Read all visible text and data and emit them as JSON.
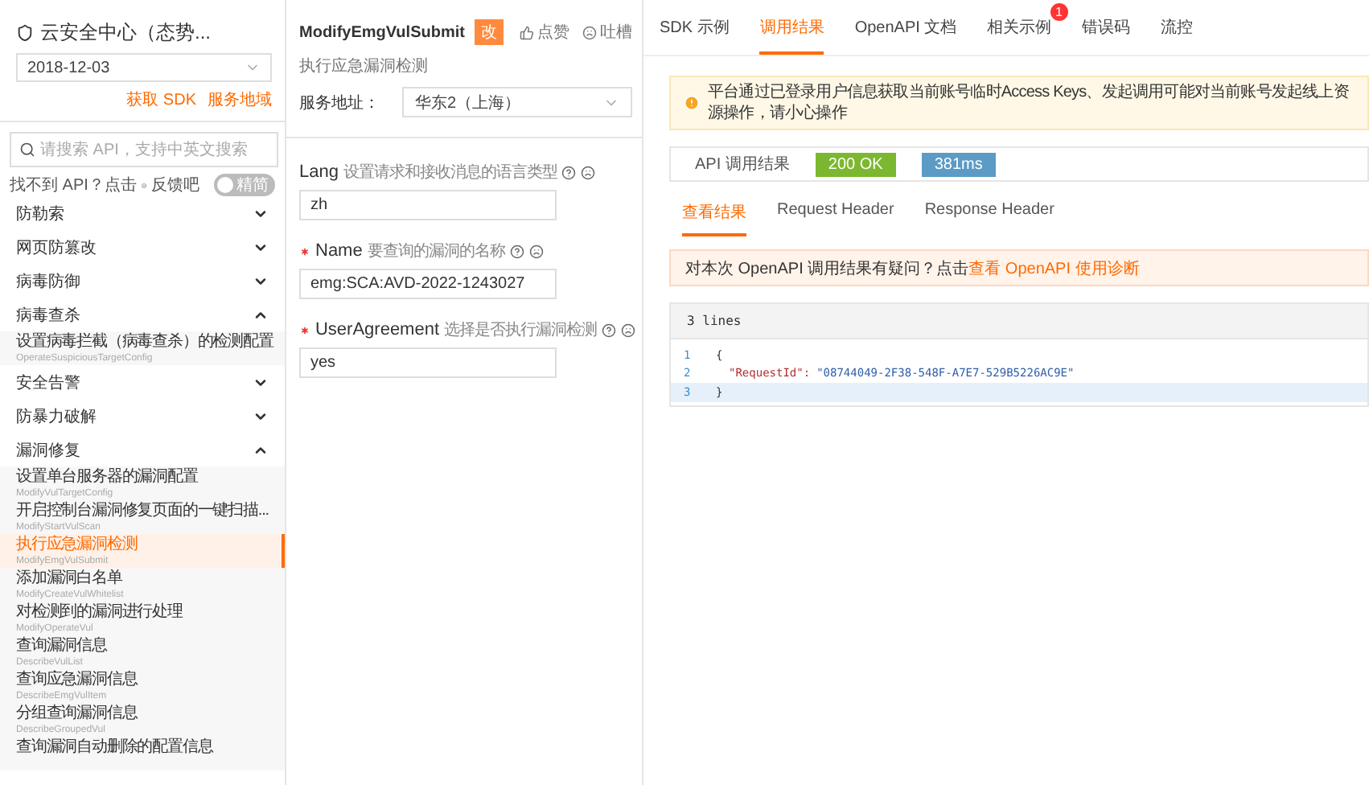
{
  "sidebar": {
    "title": "云安全中心（态势...",
    "date": "2018-12-03",
    "links": [
      "获取 SDK",
      "服务地域"
    ],
    "search": {
      "placeholder": "请搜索 API，支持中英文搜索"
    },
    "feedback": {
      "text": "找不到 API？点击",
      "link": "反馈吧"
    },
    "toggle": {
      "label": "精简",
      "on": false
    },
    "groups": [
      {
        "label": "防勒索",
        "expanded": false
      },
      {
        "label": "网页防篡改",
        "expanded": false
      },
      {
        "label": "病毒防御",
        "expanded": false
      },
      {
        "label": "病毒查杀",
        "expanded": true,
        "children": [
          {
            "title": "设置病毒拦截（病毒查杀）的检测配置",
            "api": "OperateSuspiciousTargetConfig",
            "selected": false
          }
        ]
      },
      {
        "label": "安全告警",
        "expanded": false
      },
      {
        "label": "防暴力破解",
        "expanded": false
      },
      {
        "label": "漏洞修复",
        "expanded": true,
        "children": [
          {
            "title": "设置单台服务器的漏洞配置",
            "api": "ModifyVulTargetConfig",
            "selected": false
          },
          {
            "title": "开启控制台漏洞修复页面的一键扫描...",
            "api": "ModifyStartVulScan",
            "selected": false
          },
          {
            "title": "执行应急漏洞检测",
            "api": "ModifyEmgVulSubmit",
            "selected": true
          },
          {
            "title": "添加漏洞白名单",
            "api": "ModifyCreateVulWhitelist",
            "selected": false
          },
          {
            "title": "对检测到的漏洞进行处理",
            "api": "ModifyOperateVul",
            "selected": false
          },
          {
            "title": "查询漏洞信息",
            "api": "DescribeVulList",
            "selected": false
          },
          {
            "title": "查询应急漏洞信息",
            "api": "DescribeEmgVulItem",
            "selected": false
          },
          {
            "title": "分组查询漏洞信息",
            "api": "DescribeGroupedVul",
            "selected": false
          },
          {
            "title": "查询漏洞自动删除的配置信息",
            "selected": false
          }
        ]
      }
    ]
  },
  "api": {
    "name": "ModifyEmgVulSubmit",
    "badge": "改",
    "like": "点赞",
    "complain": "吐槽",
    "description": "执行应急漏洞检测",
    "service_label": "服务地址：",
    "service_value": "华东2（上海）",
    "params": [
      {
        "name": "Lang",
        "required": false,
        "hint": "设置请求和接收消息的语言类型",
        "value": "zh"
      },
      {
        "name": "Name",
        "required": true,
        "hint": "要查询的漏洞的名称",
        "value": "emg:SCA:AVD-2022-1243027"
      },
      {
        "name": "UserAgreement",
        "required": true,
        "hint": "选择是否执行漏洞检测",
        "value": "yes"
      }
    ]
  },
  "tabs": [
    {
      "label": "SDK 示例",
      "selected": false
    },
    {
      "label": "调用结果",
      "selected": true
    },
    {
      "label": "OpenAPI 文档",
      "selected": false
    },
    {
      "label": "相关示例",
      "selected": false,
      "badge": "1"
    },
    {
      "label": "错误码",
      "selected": false
    },
    {
      "label": "流控",
      "selected": false
    }
  ],
  "warning": "平台通过已登录用户信息获取当前账号临时Access Keys、发起调用可能对当前账号发起线上资源操作，请小心操作",
  "result": {
    "label": "API 调用结果",
    "status": "200 OK",
    "time": "381ms"
  },
  "subtabs": [
    {
      "label": "查看结果",
      "selected": true
    },
    {
      "label": "Request Header",
      "selected": false
    },
    {
      "label": "Response Header",
      "selected": false
    }
  ],
  "notice": {
    "text": "对本次 OpenAPI 调用结果有疑问？点击",
    "link": "查看 OpenAPI 使用诊断"
  },
  "code": {
    "header": "3 lines",
    "lines": [
      {
        "number": "1",
        "value": "{",
        "highlighted": false
      },
      {
        "number": "2",
        "key": "\"RequestId\":",
        "value": "\"08744049-2F38-548F-A7E7-529B5226AC9E\"",
        "highlighted": false
      },
      {
        "number": "3",
        "value": "}",
        "highlighted": true
      }
    ]
  }
}
